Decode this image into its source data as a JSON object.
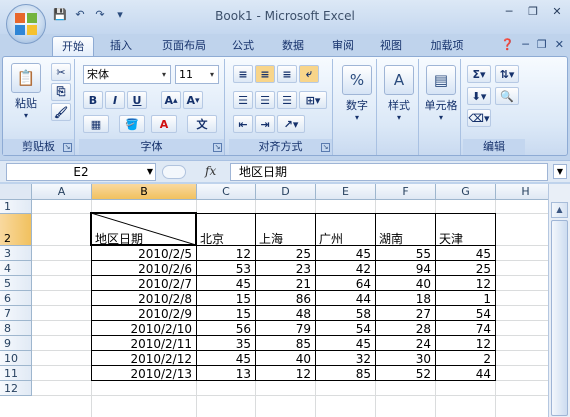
{
  "window": {
    "title": "Book1 - Microsoft Excel"
  },
  "quick_access": {
    "save_icon": "save-icon",
    "undo_icon": "undo-icon",
    "redo_icon": "redo-icon",
    "customize_icon": "customize-qat-icon"
  },
  "tabs": [
    {
      "label": "开始",
      "active": true
    },
    {
      "label": "插入"
    },
    {
      "label": "页面布局"
    },
    {
      "label": "公式"
    },
    {
      "label": "数据"
    },
    {
      "label": "审阅"
    },
    {
      "label": "视图"
    },
    {
      "label": "加载项"
    }
  ],
  "ribbon": {
    "clipboard": {
      "label": "剪贴板",
      "paste": "粘贴"
    },
    "font": {
      "label": "字体",
      "name": "宋体",
      "size": "11"
    },
    "alignment": {
      "label": "对齐方式"
    },
    "number": {
      "label": "数字",
      "btn": "数字"
    },
    "styles": {
      "btn": "样式"
    },
    "cells": {
      "btn": "单元格"
    },
    "editing": {
      "label": "编辑"
    }
  },
  "formula_bar": {
    "name_box": "E2",
    "fx": "fx",
    "content": "地区日期"
  },
  "sheet": {
    "columns": [
      "A",
      "B",
      "C",
      "D",
      "E",
      "F",
      "G",
      "H"
    ],
    "selected_column": "B",
    "rows": [
      "1",
      "2",
      "3",
      "4",
      "5",
      "6",
      "7",
      "8",
      "9",
      "10",
      "11",
      "12"
    ],
    "selected_row": "2",
    "header_cell": "地区日期",
    "cities": [
      "北京",
      "上海",
      "广州",
      "湖南",
      "天津"
    ],
    "data": [
      {
        "date": "2010/2/5",
        "values": [
          "12",
          "25",
          "45",
          "55",
          "45"
        ]
      },
      {
        "date": "2010/2/6",
        "values": [
          "53",
          "23",
          "42",
          "94",
          "25"
        ]
      },
      {
        "date": "2010/2/7",
        "values": [
          "45",
          "21",
          "64",
          "40",
          "12"
        ]
      },
      {
        "date": "2010/2/8",
        "values": [
          "15",
          "86",
          "44",
          "18",
          "1"
        ]
      },
      {
        "date": "2010/2/9",
        "values": [
          "15",
          "48",
          "58",
          "27",
          "54"
        ]
      },
      {
        "date": "2010/2/10",
        "values": [
          "56",
          "79",
          "54",
          "28",
          "74"
        ]
      },
      {
        "date": "2010/2/11",
        "values": [
          "35",
          "85",
          "45",
          "24",
          "12"
        ]
      },
      {
        "date": "2010/2/12",
        "values": [
          "45",
          "40",
          "32",
          "30",
          "2"
        ]
      },
      {
        "date": "2010/2/13",
        "values": [
          "13",
          "12",
          "85",
          "52",
          "44"
        ]
      }
    ]
  }
}
